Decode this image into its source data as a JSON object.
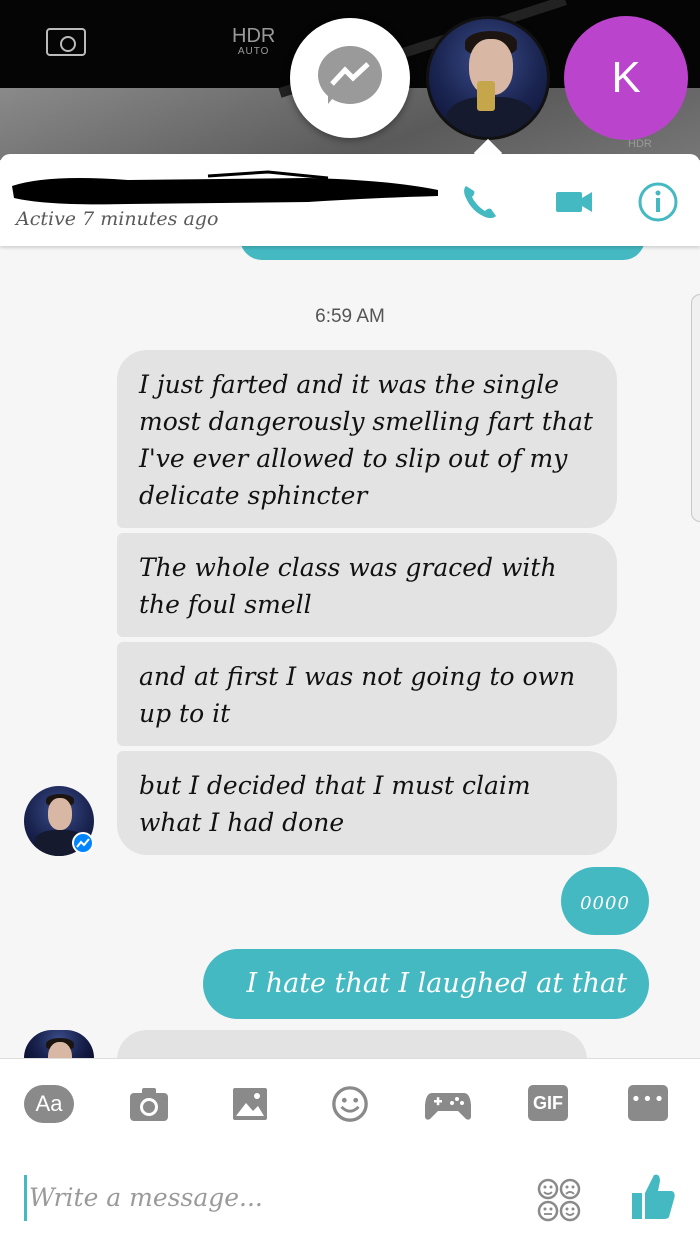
{
  "camera": {
    "hdr_label": "HDR",
    "hdr_sub": "AUTO",
    "hdr_corner": "HDR"
  },
  "chat_heads": {
    "k_initial": "K"
  },
  "header": {
    "status": "Active 7 minutes ago"
  },
  "thread": {
    "timestamp": "6:59 AM",
    "incoming": [
      "I just farted and it was the single most dangerously smelling fart that I've ever allowed to slip out of my delicate sphincter",
      "The whole class was graced with the foul smell",
      "and at first I was not going to own up to it",
      "but I decided that I must claim what I had done"
    ],
    "outgoing": [
      "0000",
      "I hate that I laughed at that"
    ]
  },
  "composer": {
    "aa_label": "Aa",
    "gif_label": "GIF",
    "more_label": "•••",
    "placeholder": "Write a message..."
  },
  "colors": {
    "accent": "#45b9c2",
    "incoming_bubble": "#e3e3e3",
    "k_head": "#bb44cc"
  },
  "icons": [
    "rotate-camera-icon",
    "messenger-icon",
    "phone-icon",
    "video-icon",
    "info-icon",
    "camera-icon",
    "image-icon",
    "emoji-icon",
    "game-icon",
    "stickers-icon",
    "thumbs-up-icon"
  ]
}
